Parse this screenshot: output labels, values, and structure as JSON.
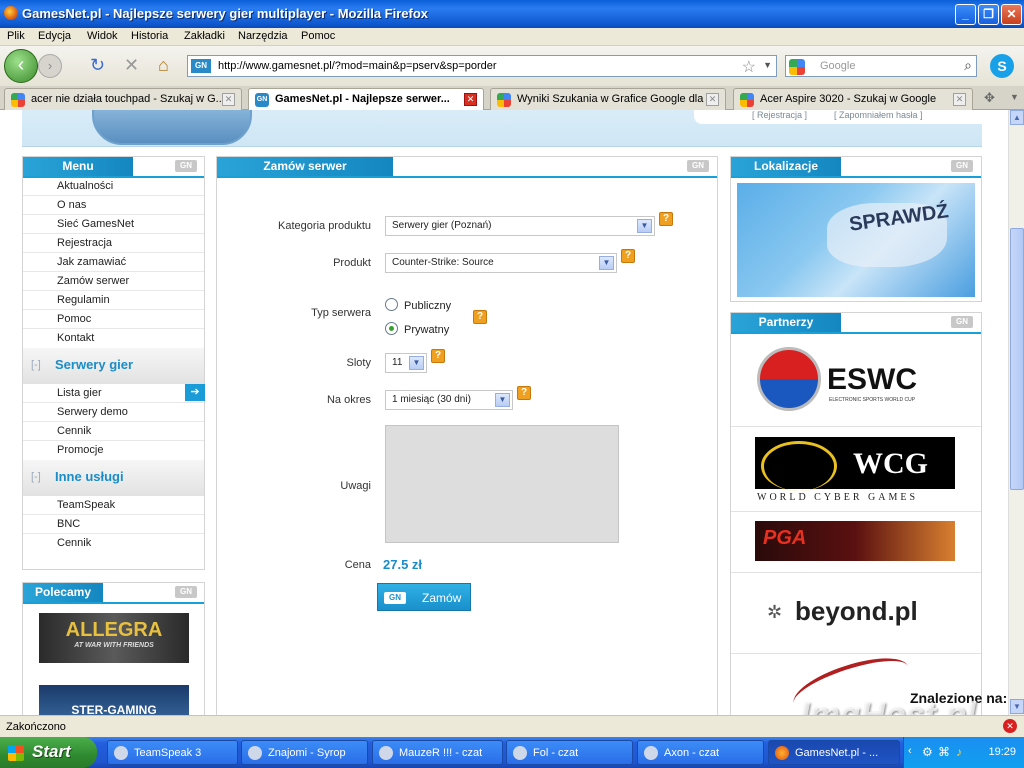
{
  "window": {
    "title": "GamesNet.pl - Najlepsze serwery gier multiplayer - Mozilla Firefox"
  },
  "menubar": [
    "Plik",
    "Edycja",
    "Widok",
    "Historia",
    "Zakładki",
    "Narzędzia",
    "Pomoc"
  ],
  "navbar": {
    "url": "http://www.gamesnet.pl/?mod=main&p=pserv&sp=porder",
    "search_placeholder": "Google"
  },
  "tabs": [
    {
      "label": "acer nie działa touchpad - Szukaj w G..."
    },
    {
      "label": "GamesNet.pl - Najlepsze serwer...",
      "active": true
    },
    {
      "label": "Wyniki Szukania w Grafice Google dla ..."
    },
    {
      "label": "Acer Aspire 3020 - Szukaj w Google"
    }
  ],
  "header": {
    "link_register": "[ Rejestracja ]",
    "link_forgot": "[ Zapomniałem hasła ]"
  },
  "gn_mark": "GN",
  "menu": {
    "title": "Menu",
    "items": [
      "Aktualności",
      "O nas",
      "Sieć GamesNet",
      "Rejestracja",
      "Jak zamawiać",
      "Zamów serwer",
      "Regulamin",
      "Pomoc",
      "Kontakt"
    ],
    "section_bracket": "[-]",
    "section1": {
      "title": "Serwery gier",
      "items": [
        "Lista gier",
        "Serwery demo",
        "Cennik",
        "Promocje"
      ]
    },
    "section2": {
      "title": "Inne usługi",
      "items": [
        "TeamSpeak",
        "BNC",
        "Cennik"
      ]
    }
  },
  "recommend": {
    "title": "Polecamy",
    "banner1": "ALLEGRA",
    "banner1_sub": "AT WAR WITH FRIENDS",
    "banner2": "STER-GAMING"
  },
  "order": {
    "title": "Zamów serwer",
    "category_label": "Kategoria produktu",
    "category_value": "Serwery gier (Poznań)",
    "product_label": "Produkt",
    "product_value": "Counter-Strike: Source",
    "type_label": "Typ serwera",
    "type_options": [
      "Publiczny",
      "Prywatny"
    ],
    "type_selected": "Prywatny",
    "slots_label": "Sloty",
    "slots_value": "11",
    "period_label": "Na okres",
    "period_value": "1 miesiąc (30 dni)",
    "notes_label": "Uwagi",
    "price_label": "Cena",
    "price_value": "27.5 zł",
    "submit_label": "Zamów",
    "help": "?"
  },
  "location": {
    "title": "Lokalizacje",
    "map_text": "SPRAWDŹ"
  },
  "partners": {
    "title": "Partnerzy",
    "items": [
      "ESWC",
      "WCG",
      "PGA",
      "beyond.pl"
    ],
    "eswc_sub": "ELECTRONIC SPORTS WORLD CUP",
    "wcg_sub": "WORLD CYBER GAMES"
  },
  "status": {
    "text": "Zakończono"
  },
  "overlay": {
    "found_on": "Znalezione na:",
    "watermark": "ImgHost.pl"
  },
  "taskbar": {
    "start": "Start",
    "tasks": [
      "TeamSpeak 3",
      "Znajomi - Syrop",
      "MauzeR !!! - czat",
      "Fol - czat",
      "Axon - czat",
      "GamesNet.pl - ..."
    ],
    "clock": "19:29"
  },
  "colors": {
    "accent": "#1a8cc8",
    "help": "#f0a020",
    "titlebar": "#0a5fd8"
  }
}
